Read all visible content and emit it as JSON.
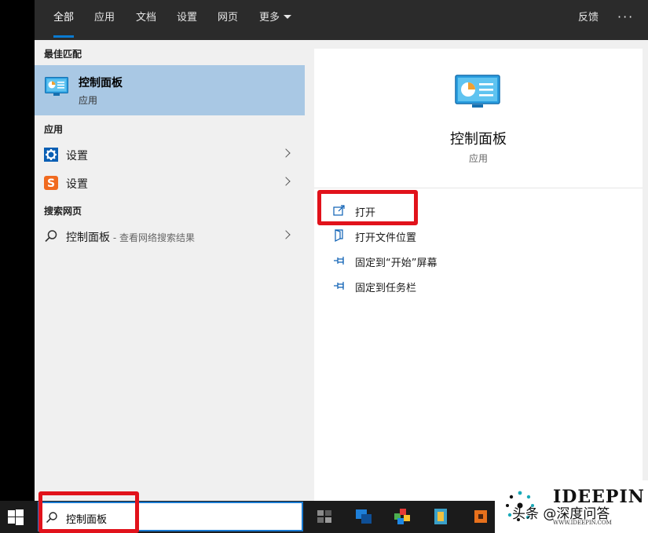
{
  "tabs": [
    {
      "label": "全部"
    },
    {
      "label": "应用"
    },
    {
      "label": "文档"
    },
    {
      "label": "设置"
    },
    {
      "label": "网页"
    },
    {
      "label": "更多"
    }
  ],
  "header": {
    "feedback": "反馈",
    "more_options": "···"
  },
  "left": {
    "best_match_header": "最佳匹配",
    "best_match": {
      "title": "控制面板",
      "subtitle": "应用",
      "icon": "control-panel-icon"
    },
    "apps_header": "应用",
    "apps": [
      {
        "label": "设置",
        "icon": "gear-icon"
      },
      {
        "label": "设置",
        "icon": "sogou-s-icon"
      }
    ],
    "web_header": "搜索网页",
    "web": {
      "label": "控制面板",
      "suffix": " - 查看网络搜索结果",
      "icon": "search-icon"
    }
  },
  "detail": {
    "title": "控制面板",
    "subtitle": "应用",
    "actions": [
      {
        "label": "打开",
        "icon": "open-icon"
      },
      {
        "label": "打开文件位置",
        "icon": "file-location-icon"
      },
      {
        "label": "固定到“开始”屏幕",
        "icon": "pin-icon"
      },
      {
        "label": "固定到任务栏",
        "icon": "pin-icon"
      }
    ]
  },
  "taskbar": {
    "search_value": "控制面板"
  },
  "watermark": {
    "brand": "IDEEPIN",
    "cn": "头条 @深度问答",
    "url": "WWW.IDEEPIN.COM"
  },
  "colors": {
    "accent": "#0a7ad1",
    "highlight": "#e1121b",
    "selection": "#a9c8e4"
  }
}
